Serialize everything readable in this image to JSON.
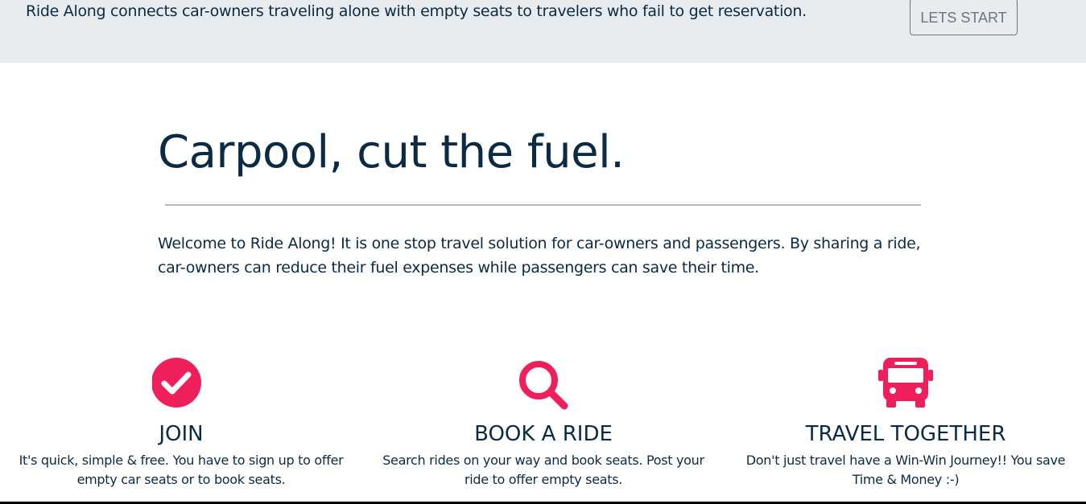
{
  "banner": {
    "text": "Ride Along connects car-owners traveling alone with empty seats to travelers who fail to get reservation.",
    "button_label": "LETS START"
  },
  "hero": {
    "title": "Carpool, cut the fuel.",
    "intro": "Welcome to Ride Along! It is one stop travel solution for car-owners and passengers. By sharing a ride, car-owners can reduce their fuel expenses while passengers can save their time."
  },
  "features": [
    {
      "icon": "check-circle-icon",
      "title": "JOIN",
      "description": "It's quick, simple & free. You have to sign up to offer empty car seats or to book seats."
    },
    {
      "icon": "search-icon",
      "title": "BOOK A RIDE",
      "description": "Search rides on your way and book seats. Post your ride to offer empty seats."
    },
    {
      "icon": "bus-icon",
      "title": "TRAVEL TOGETHER",
      "description": "Don't just travel have a Win-Win Journey!! You save Time & Money :-)"
    }
  ],
  "colors": {
    "accent": "#ee1f5b",
    "text": "#0b2a44",
    "banner_bg": "#e9ecef",
    "button_border": "#6c757d"
  }
}
